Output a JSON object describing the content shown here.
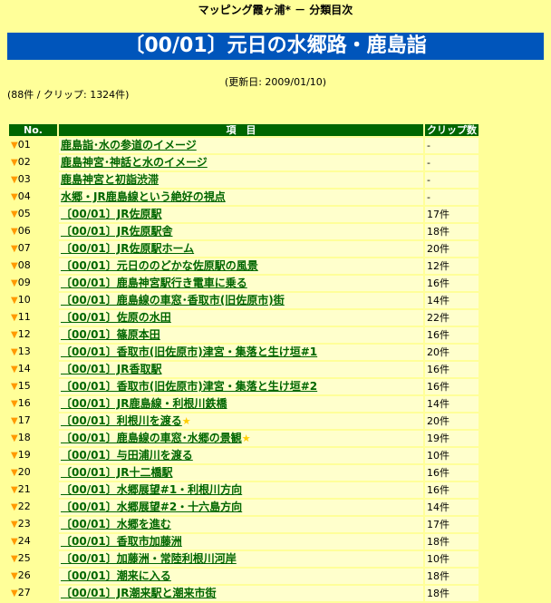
{
  "site_title": "マッピング霞ヶ浦* － 分類目次",
  "header_title": "〔00/01〕元日の水郷路・鹿島詣",
  "updated": "(更新日: 2009/01/10)",
  "counts": "(88件 / クリップ: 1324件)",
  "table": {
    "columns": [
      "No.",
      "項　目",
      "クリップ数"
    ],
    "row_marker": "▼",
    "star_icon": "★",
    "rows": [
      {
        "no": "01",
        "title": "鹿島詣･水の参道のイメージ",
        "clip": "-",
        "star": false
      },
      {
        "no": "02",
        "title": "鹿島神宮･神話と水のイメージ",
        "clip": "-",
        "star": false
      },
      {
        "no": "03",
        "title": "鹿島神宮と初詣渋滞",
        "clip": "-",
        "star": false
      },
      {
        "no": "04",
        "title": "水郷・JR鹿島線という絶好の視点",
        "clip": "-",
        "star": false
      },
      {
        "no": "05",
        "title": "〔00/01〕JR佐原駅",
        "clip": "17件",
        "star": false
      },
      {
        "no": "06",
        "title": "〔00/01〕JR佐原駅舎",
        "clip": "18件",
        "star": false
      },
      {
        "no": "07",
        "title": "〔00/01〕JR佐原駅ホーム",
        "clip": "20件",
        "star": false
      },
      {
        "no": "08",
        "title": "〔00/01〕元日ののどかな佐原駅の風景",
        "clip": "12件",
        "star": false
      },
      {
        "no": "09",
        "title": "〔00/01〕鹿島神宮駅行き電車に乗る",
        "clip": "16件",
        "star": false
      },
      {
        "no": "10",
        "title": "〔00/01〕鹿島線の車窓･香取市(旧佐原市)街",
        "clip": "14件",
        "star": false
      },
      {
        "no": "11",
        "title": "〔00/01〕佐原の水田",
        "clip": "22件",
        "star": false
      },
      {
        "no": "12",
        "title": "〔00/01〕篠原本田",
        "clip": "16件",
        "star": false
      },
      {
        "no": "13",
        "title": "〔00/01〕香取市(旧佐原市)津宮・集落と生け垣#1",
        "clip": "20件",
        "star": false
      },
      {
        "no": "14",
        "title": "〔00/01〕JR香取駅",
        "clip": "16件",
        "star": false
      },
      {
        "no": "15",
        "title": "〔00/01〕香取市(旧佐原市)津宮・集落と生け垣#2",
        "clip": "16件",
        "star": false
      },
      {
        "no": "16",
        "title": "〔00/01〕JR鹿島線・利根川鉄橋",
        "clip": "14件",
        "star": false
      },
      {
        "no": "17",
        "title": "〔00/01〕利根川を渡る",
        "clip": "20件",
        "star": true
      },
      {
        "no": "18",
        "title": "〔00/01〕鹿島線の車窓･水郷の景観",
        "clip": "19件",
        "star": true
      },
      {
        "no": "19",
        "title": "〔00/01〕与田浦川を渡る",
        "clip": "10件",
        "star": false
      },
      {
        "no": "20",
        "title": "〔00/01〕JR十二橋駅",
        "clip": "16件",
        "star": false
      },
      {
        "no": "21",
        "title": "〔00/01〕水郷展望#1・利根川方向",
        "clip": "16件",
        "star": false
      },
      {
        "no": "22",
        "title": "〔00/01〕水郷展望#2・十六島方向",
        "clip": "14件",
        "star": false
      },
      {
        "no": "23",
        "title": "〔00/01〕水郷を進む",
        "clip": "17件",
        "star": false
      },
      {
        "no": "24",
        "title": "〔00/01〕香取市加藤洲",
        "clip": "18件",
        "star": false
      },
      {
        "no": "25",
        "title": "〔00/01〕加藤洲・常陸利根川河岸",
        "clip": "10件",
        "star": false
      },
      {
        "no": "26",
        "title": "〔00/01〕潮来に入る",
        "clip": "18件",
        "star": false
      },
      {
        "no": "27",
        "title": "〔00/01〕JR潮来駅と潮来市街",
        "clip": "18件",
        "star": false
      }
    ]
  }
}
